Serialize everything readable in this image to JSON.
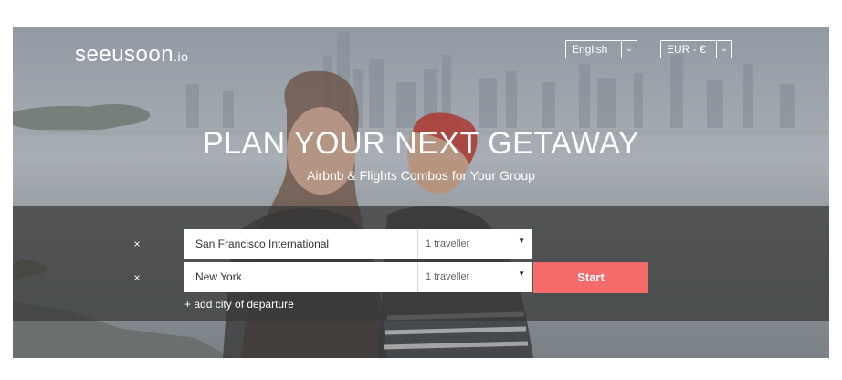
{
  "brand": {
    "name": "seeusoon",
    "tld": ".io"
  },
  "language_select": {
    "value": "English"
  },
  "currency_select": {
    "value": "EUR - €"
  },
  "hero": {
    "title": "PLAN YOUR NEXT GETAWAY",
    "subtitle": "Airbnb & Flights Combos for Your Group"
  },
  "search": {
    "rows": [
      {
        "remove": "×",
        "city": "San Francisco International",
        "travellers": "1 traveller"
      },
      {
        "remove": "×",
        "city": "New York",
        "travellers": "1 traveller"
      }
    ],
    "start_label": "Start",
    "add_city_label": "+ add city of departure"
  },
  "colors": {
    "accent": "#f56a6a",
    "band": "#373737",
    "text": "#ffffff"
  }
}
